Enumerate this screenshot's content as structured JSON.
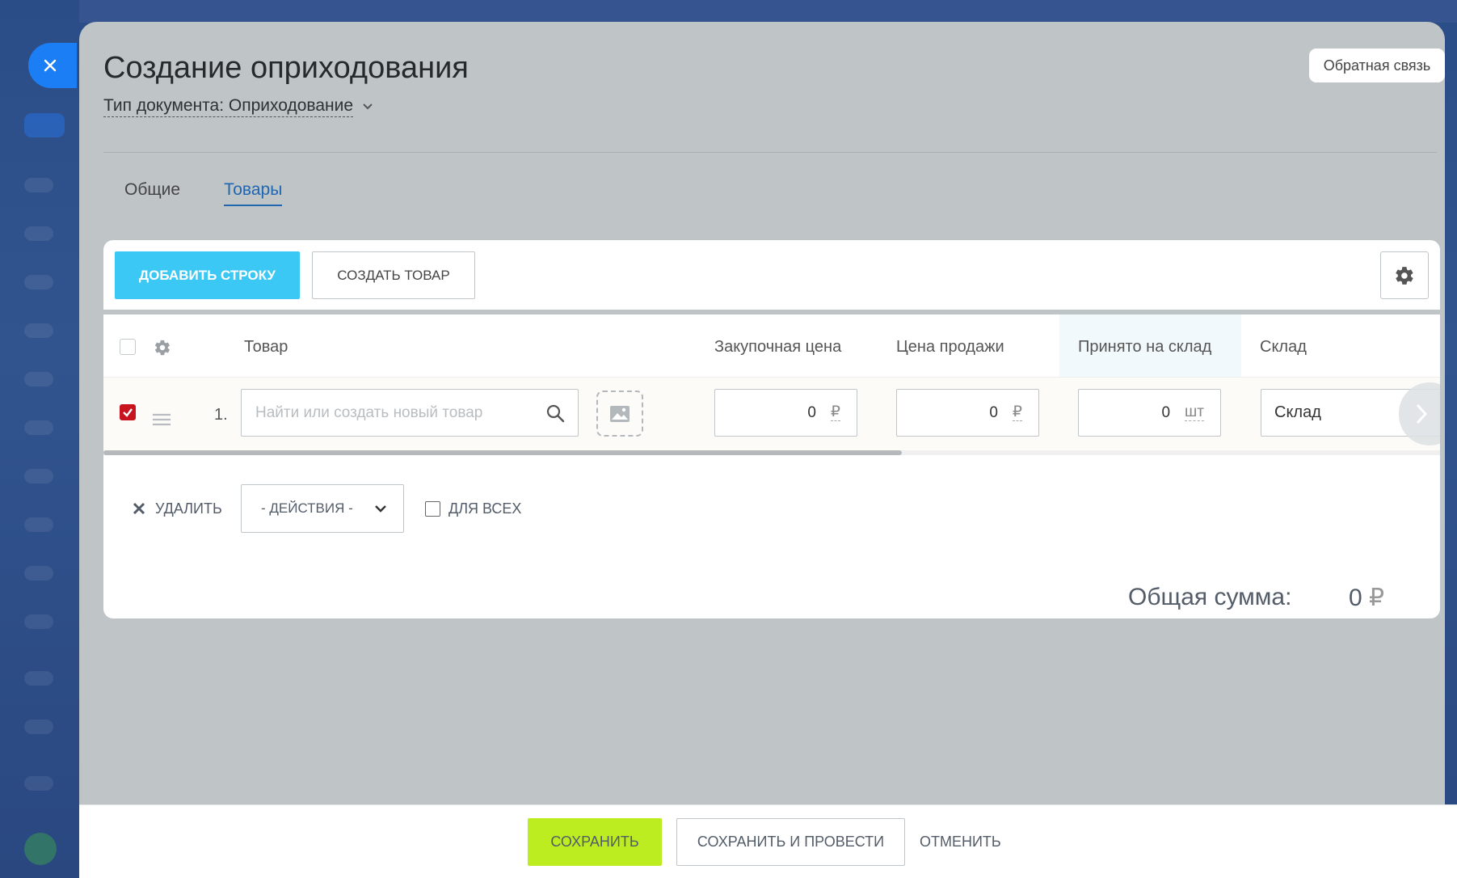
{
  "slider": {
    "title": "Создание оприходования",
    "doc_type_label": "Тип документа: Оприходование",
    "feedback_label": "Обратная связь"
  },
  "tabs": [
    {
      "label": "Общие",
      "active": false
    },
    {
      "label": "Товары",
      "active": true
    }
  ],
  "toolbar": {
    "add_row_label": "ДОБАВИТЬ СТРОКУ",
    "create_product_label": "СОЗДАТЬ ТОВАР",
    "settings_icon": "gear-icon"
  },
  "table": {
    "columns": [
      "Товар",
      "Закупочная цена",
      "Цена продажи",
      "Принято на склад",
      "Склад"
    ],
    "rows": [
      {
        "checked": true,
        "number": "1.",
        "product_placeholder": "Найти или создать новый товар",
        "purchase_price": "0",
        "purchase_currency": "₽",
        "sale_price": "0",
        "sale_currency": "₽",
        "accepted_qty": "0",
        "accepted_unit": "шт",
        "warehouse": "Склад"
      }
    ]
  },
  "actions": {
    "delete_label": "УДАЛИТЬ",
    "actions_select": "- ДЕЙСТВИЯ -",
    "for_all_label": "ДЛЯ ВСЕХ"
  },
  "total": {
    "label": "Общая сумма:",
    "value": "0",
    "currency": "₽"
  },
  "footer": {
    "save_label": "СОХРАНИТЬ",
    "save_conduct_label": "СОХРАНИТЬ И ПРОВЕСТИ",
    "cancel_label": "ОТМЕНИТЬ"
  },
  "colors": {
    "accent_blue": "#3bc8f5",
    "save_green": "#bbed21",
    "checkbox_red": "#c7141f",
    "tab_active": "#2066b0"
  }
}
